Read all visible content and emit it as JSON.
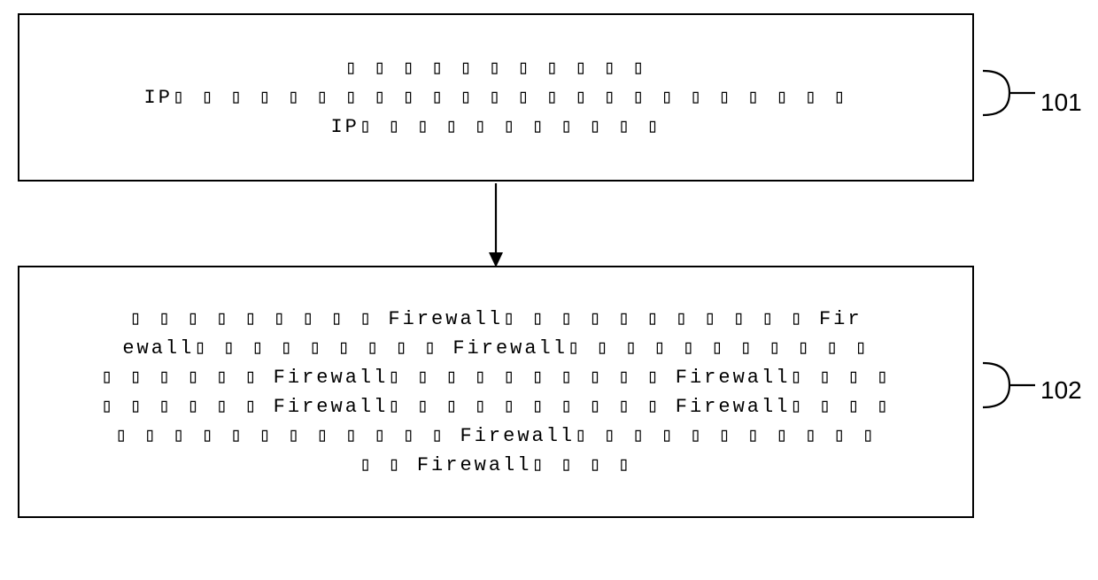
{
  "diagram": {
    "box1": {
      "label": "101",
      "lines": [
        "▯ ▯ ▯ ▯ ▯ ▯ ▯ ▯ ▯ ▯ ▯",
        "IP▯ ▯ ▯ ▯ ▯ ▯ ▯ ▯ ▯ ▯ ▯ ▯ ▯ ▯ ▯ ▯ ▯ ▯ ▯ ▯ ▯ ▯ ▯ ▯",
        "IP▯ ▯ ▯ ▯ ▯ ▯ ▯ ▯ ▯ ▯ ▯"
      ]
    },
    "box2": {
      "label": "102",
      "lines": [
        "▯ ▯ ▯ ▯ ▯ ▯ ▯ ▯ ▯ Firewall▯ ▯ ▯ ▯ ▯ ▯ ▯ ▯ ▯ ▯ ▯ Fir",
        "ewall▯ ▯ ▯ ▯ ▯ ▯ ▯ ▯ ▯ Firewall▯ ▯ ▯ ▯ ▯ ▯ ▯ ▯ ▯ ▯ ▯",
        "▯ ▯ ▯ ▯ ▯ ▯ Firewall▯ ▯ ▯ ▯ ▯ ▯ ▯ ▯ ▯ ▯ Firewall▯ ▯ ▯ ▯",
        "▯ ▯ ▯ ▯ ▯ ▯ Firewall▯ ▯ ▯ ▯ ▯ ▯ ▯ ▯ ▯ ▯ Firewall▯ ▯ ▯ ▯",
        "▯ ▯ ▯ ▯ ▯ ▯ ▯ ▯ ▯ ▯ ▯ ▯ Firewall▯ ▯ ▯ ▯ ▯ ▯ ▯ ▯ ▯ ▯ ▯",
        "▯ ▯ Firewall▯ ▯ ▯ ▯"
      ]
    }
  }
}
